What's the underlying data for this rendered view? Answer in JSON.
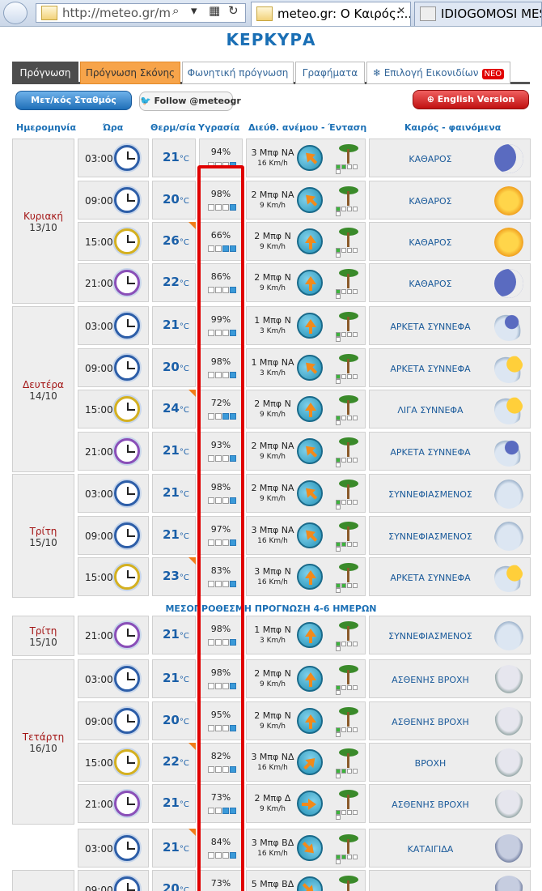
{
  "browser": {
    "url": "http://meteo.gr/m",
    "tab1": "meteo.gr: Ο Καιρός:...",
    "tab2": "IDIOGOMOSI MESS"
  },
  "city": "ΚΕΡΚΥΡΑ",
  "tabs": [
    "Πρόγνωση",
    "Πρόγνωση Σκόνης",
    "Φωνητική πρόγνωση",
    "Γραφήματα",
    "Επιλογή Εικονιδίων"
  ],
  "neo": "ΝΕΟ",
  "buttons": {
    "stations": "Μετ/κός Σταθμός",
    "follow": "Follow @meteogr",
    "english": "English Version"
  },
  "headers": [
    "Ημερομηνία",
    "Ώρα",
    "Θερμ/σία",
    "Υγρασία",
    "Διεύθ. ανέμου - Ένταση",
    "Καιρός - φαινόμενα"
  ],
  "mid_header": "ΜΕΣΟΠΡΟΘΕΣΜΗ ΠΡΟΓΝΩΣΗ 4-6 ΗΜΕΡΩΝ",
  "unit": "°C",
  "days": [
    {
      "name": "Κυριακή",
      "date": "13/10"
    },
    {
      "name": "Δευτέρα",
      "date": "14/10"
    },
    {
      "name": "Τρίτη",
      "date": "15/10"
    },
    {
      "name": "Τρίτη",
      "date": "15/10"
    },
    {
      "name": "Τετάρτη",
      "date": "16/10"
    }
  ],
  "rows": [
    {
      "time": "03:00",
      "temp": "21",
      "hum": "94%",
      "bars": 4,
      "wind": "3 Μπφ ΝΑ",
      "kmh": "16 Km/h",
      "weather": "ΚΑΘΑΡΟΣ",
      "icon": "moon",
      "beau": 2
    },
    {
      "time": "09:00",
      "temp": "20",
      "hum": "98%",
      "bars": 4,
      "wind": "2 Μπφ ΝΑ",
      "kmh": "9 Km/h",
      "weather": "ΚΑΘΑΡΟΣ",
      "icon": "sun",
      "beau": 1
    },
    {
      "time": "15:00",
      "temp": "26",
      "hum": "66%",
      "bars": 3,
      "wind": "2 Μπφ Ν",
      "kmh": "9 Km/h",
      "weather": "ΚΑΘΑΡΟΣ",
      "icon": "sun",
      "beau": 1
    },
    {
      "time": "21:00",
      "temp": "22",
      "hum": "86%",
      "bars": 4,
      "wind": "2 Μπφ Ν",
      "kmh": "9 Km/h",
      "weather": "ΚΑΘΑΡΟΣ",
      "icon": "moon",
      "beau": 1
    },
    {
      "time": "03:00",
      "temp": "21",
      "hum": "99%",
      "bars": 4,
      "wind": "1 Μπφ Ν",
      "kmh": "3 Km/h",
      "weather": "ΑΡΚΕΤΑ ΣΥΝΝΕΦΑ",
      "icon": "mcloud",
      "beau": 1
    },
    {
      "time": "09:00",
      "temp": "20",
      "hum": "98%",
      "bars": 4,
      "wind": "1 Μπφ ΝΑ",
      "kmh": "3 Km/h",
      "weather": "ΑΡΚΕΤΑ ΣΥΝΝΕΦΑ",
      "icon": "pcloud",
      "beau": 1
    },
    {
      "time": "15:00",
      "temp": "24",
      "hum": "72%",
      "bars": 3,
      "wind": "2 Μπφ Ν",
      "kmh": "9 Km/h",
      "weather": "ΛΙΓΑ ΣΥΝΝΕΦΑ",
      "icon": "pcloud",
      "beau": 1
    },
    {
      "time": "21:00",
      "temp": "21",
      "hum": "93%",
      "bars": 4,
      "wind": "2 Μπφ ΝΑ",
      "kmh": "9 Km/h",
      "weather": "ΑΡΚΕΤΑ ΣΥΝΝΕΦΑ",
      "icon": "mcloud",
      "beau": 1
    },
    {
      "time": "03:00",
      "temp": "21",
      "hum": "98%",
      "bars": 4,
      "wind": "2 Μπφ ΝΑ",
      "kmh": "9 Km/h",
      "weather": "ΣΥΝΝΕΦΙΑΣΜΕΝΟΣ",
      "icon": "cloud",
      "beau": 1
    },
    {
      "time": "09:00",
      "temp": "21",
      "hum": "97%",
      "bars": 4,
      "wind": "3 Μπφ ΝΑ",
      "kmh": "16 Km/h",
      "weather": "ΣΥΝΝΕΦΙΑΣΜΕΝΟΣ",
      "icon": "cloud",
      "beau": 2
    },
    {
      "time": "15:00",
      "temp": "23",
      "hum": "83%",
      "bars": 4,
      "wind": "3 Μπφ Ν",
      "kmh": "16 Km/h",
      "weather": "ΑΡΚΕΤΑ ΣΥΝΝΕΦΑ",
      "icon": "pcloud",
      "beau": 2
    },
    {
      "time": "21:00",
      "temp": "21",
      "hum": "98%",
      "bars": 4,
      "wind": "1 Μπφ Ν",
      "kmh": "3 Km/h",
      "weather": "ΣΥΝΝΕΦΙΑΣΜΕΝΟΣ",
      "icon": "cloud",
      "beau": 1
    },
    {
      "time": "03:00",
      "temp": "21",
      "hum": "98%",
      "bars": 4,
      "wind": "2 Μπφ Ν",
      "kmh": "9 Km/h",
      "weather": "ΑΣΘΕΝΗΣ ΒΡΟΧΗ",
      "icon": "rain",
      "beau": 1
    },
    {
      "time": "09:00",
      "temp": "20",
      "hum": "95%",
      "bars": 4,
      "wind": "2 Μπφ Ν",
      "kmh": "9 Km/h",
      "weather": "ΑΣΘΕΝΗΣ ΒΡΟΧΗ",
      "icon": "rain",
      "beau": 1
    },
    {
      "time": "15:00",
      "temp": "22",
      "hum": "82%",
      "bars": 4,
      "wind": "3 Μπφ ΝΔ",
      "kmh": "16 Km/h",
      "weather": "ΒΡΟΧΗ",
      "icon": "rain",
      "beau": 2
    },
    {
      "time": "21:00",
      "temp": "21",
      "hum": "73%",
      "bars": 3,
      "wind": "2 Μπφ Δ",
      "kmh": "9 Km/h",
      "weather": "ΑΣΘΕΝΗΣ ΒΡΟΧΗ",
      "icon": "rain",
      "beau": 1
    },
    {
      "time": "03:00",
      "temp": "21",
      "hum": "84%",
      "bars": 4,
      "wind": "3 Μπφ ΒΔ",
      "kmh": "16 Km/h",
      "weather": "ΚΑΤΑΙΓΙΔΑ",
      "icon": "storm",
      "beau": 2
    },
    {
      "time": "09:00",
      "temp": "20",
      "hum": "73%",
      "bars": 3,
      "wind": "5 Μπφ ΒΔ",
      "kmh": "",
      "weather": "",
      "icon": "storm",
      "beau": 3
    }
  ],
  "markers": [
    2,
    6,
    10,
    14,
    16
  ]
}
